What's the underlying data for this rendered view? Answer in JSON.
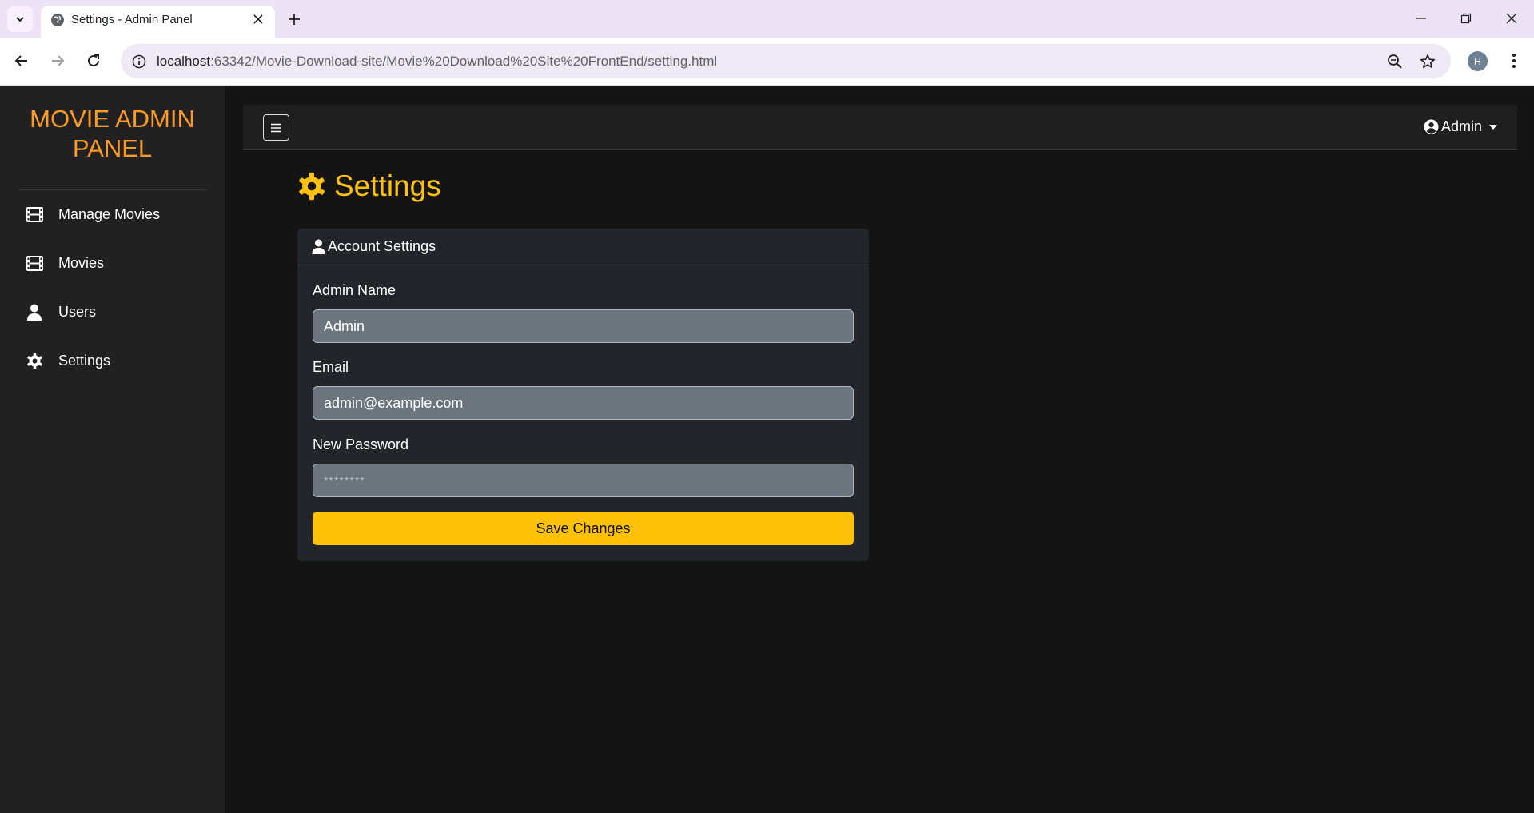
{
  "browser": {
    "tab_title": "Settings - Admin Panel",
    "url_host": "localhost",
    "url_rest": ":63342/Movie-Download-site/Movie%20Download%20Site%20FrontEnd/setting.html",
    "profile_initial": "H"
  },
  "sidebar": {
    "brand": "MOVIE ADMIN PANEL",
    "items": [
      {
        "label": "Manage Movies",
        "icon": "film-icon"
      },
      {
        "label": "Movies",
        "icon": "film-icon"
      },
      {
        "label": "Users",
        "icon": "user-icon"
      },
      {
        "label": "Settings",
        "icon": "gear-icon"
      }
    ]
  },
  "topbar": {
    "user_label": "Admin"
  },
  "page": {
    "title": "Settings"
  },
  "account_card": {
    "header": "Account Settings",
    "admin_name_label": "Admin Name",
    "admin_name_value": "Admin",
    "email_label": "Email",
    "email_value": "admin@example.com",
    "password_label": "New Password",
    "password_value": "********",
    "save_label": "Save Changes"
  },
  "colors": {
    "brand": "#fd9a26",
    "accent": "#fdc00e",
    "sidebar_bg": "#212121",
    "page_bg": "#141414",
    "card_bg": "#22262b",
    "field_bg": "#6c757d",
    "button_bg": "#fdc107"
  }
}
